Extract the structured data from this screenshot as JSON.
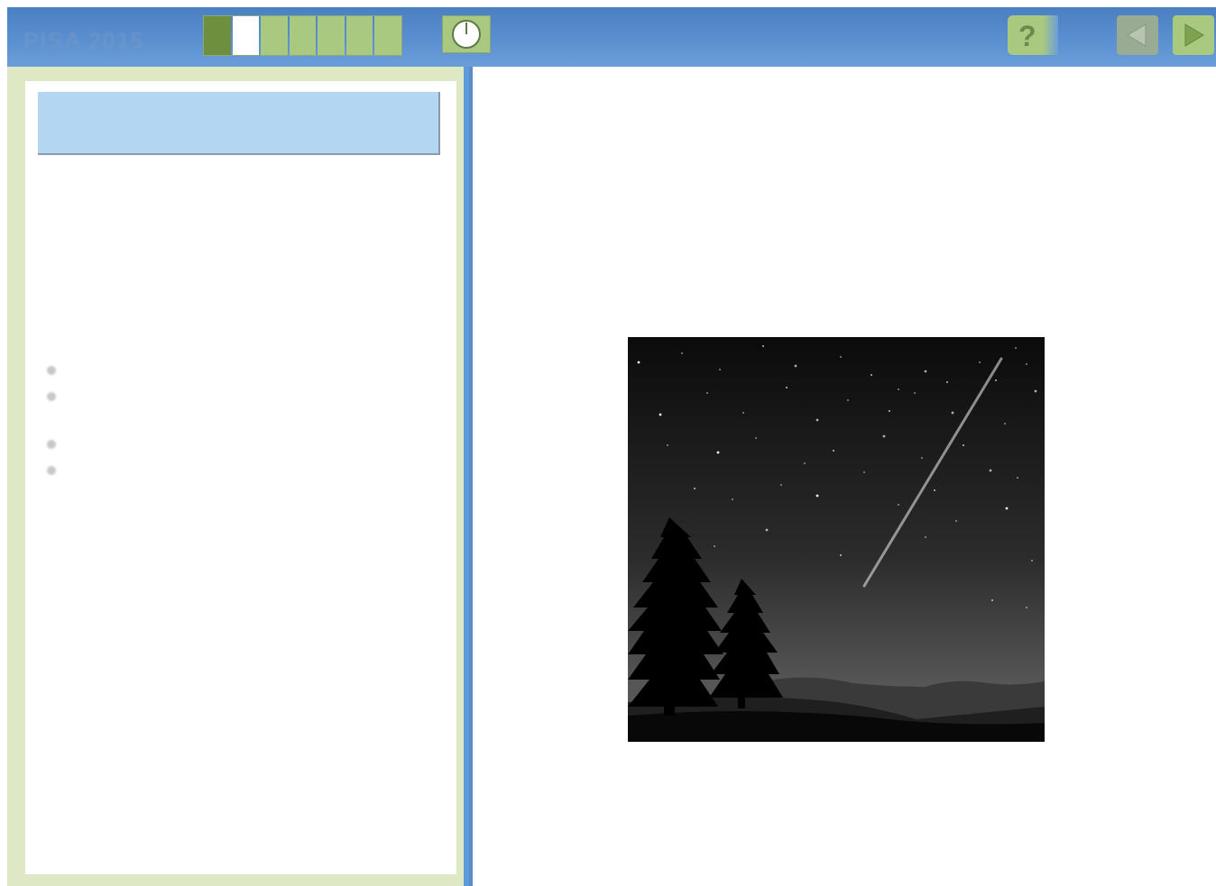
{
  "app": {
    "brand_text": "PISA 2015",
    "colors": {
      "toolbar": "#4a7fc2",
      "panel_border": "#dfe8c4",
      "accent_green": "#a8c97f",
      "header_blue": "#b3d6f2"
    }
  },
  "toolbar": {
    "progress": {
      "current": 2,
      "total": 7
    },
    "timer_icon": "clock-icon",
    "help_icon": "question-mark-icon",
    "help_label": "?",
    "prev_icon": "triangle-left-icon",
    "next_icon": "triangle-right-icon"
  },
  "left_panel": {
    "bullet_count": 4
  },
  "right_panel": {
    "image_icon": "night-sky-shooting-star-scene"
  }
}
